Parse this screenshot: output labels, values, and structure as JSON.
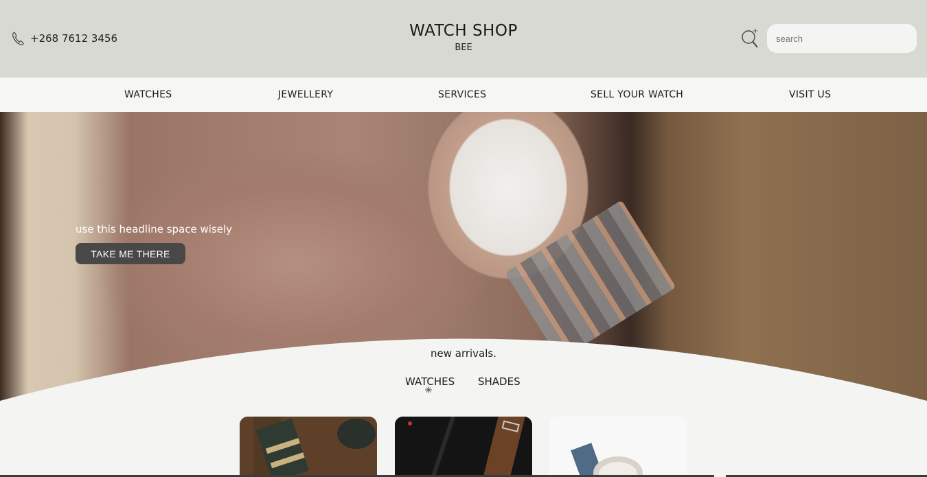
{
  "header": {
    "phone": "+268 7612 3456",
    "phone_icon": "phone-icon",
    "brand_title": "WATCH SHOP",
    "brand_sub": "BEE",
    "search_icon": "search-icon",
    "search_placeholder": "search"
  },
  "nav": {
    "items": [
      {
        "label": "WATCHES"
      },
      {
        "label": "JEWELLERY"
      },
      {
        "label": "SERVICES"
      },
      {
        "label": "SELL YOUR WATCH"
      },
      {
        "label": "VISIT US"
      }
    ]
  },
  "hero": {
    "headline": "use this headline space wisely",
    "button_label": "TAKE ME THERE"
  },
  "arrivals": {
    "title": "new arrivals.",
    "tabs": [
      {
        "label": "WATCHES",
        "active": true
      },
      {
        "label": "SHADES",
        "active": false
      }
    ],
    "cards": [
      {
        "image": "nato-strap-watch-photo"
      },
      {
        "image": "leather-strap-watch-photo"
      },
      {
        "image": "blue-strap-watch-photo"
      }
    ]
  },
  "colors": {
    "header_bg": "#d9d9d4",
    "nav_bg": "#f6f6f4",
    "button_bg": "#4a4847",
    "page_bg": "#f4f4f2"
  }
}
